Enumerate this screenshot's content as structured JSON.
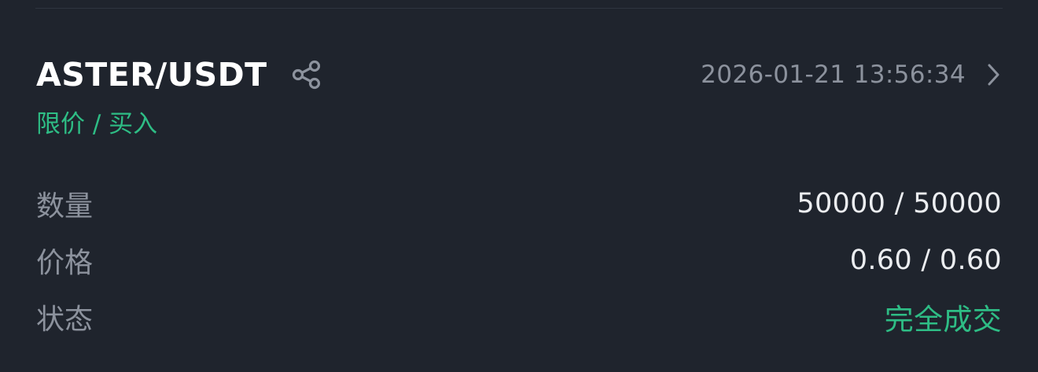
{
  "order": {
    "pair": "ASTER/USDT",
    "datetime": "2026-01-21 13:56:34",
    "order_type": "限价 / 买入",
    "details": [
      {
        "label": "数量",
        "value": "50000 / 50000"
      },
      {
        "label": "价格",
        "value": "0.60 / 0.60"
      },
      {
        "label": "状态",
        "value": "完全成交"
      }
    ]
  },
  "icons": {
    "share": "share-icon",
    "chevron": "chevron-right-icon"
  },
  "colors": {
    "background": "#1f242d",
    "accent_green": "#2ebd85",
    "muted_text": "#8c929d",
    "primary_text": "#ffffff"
  }
}
